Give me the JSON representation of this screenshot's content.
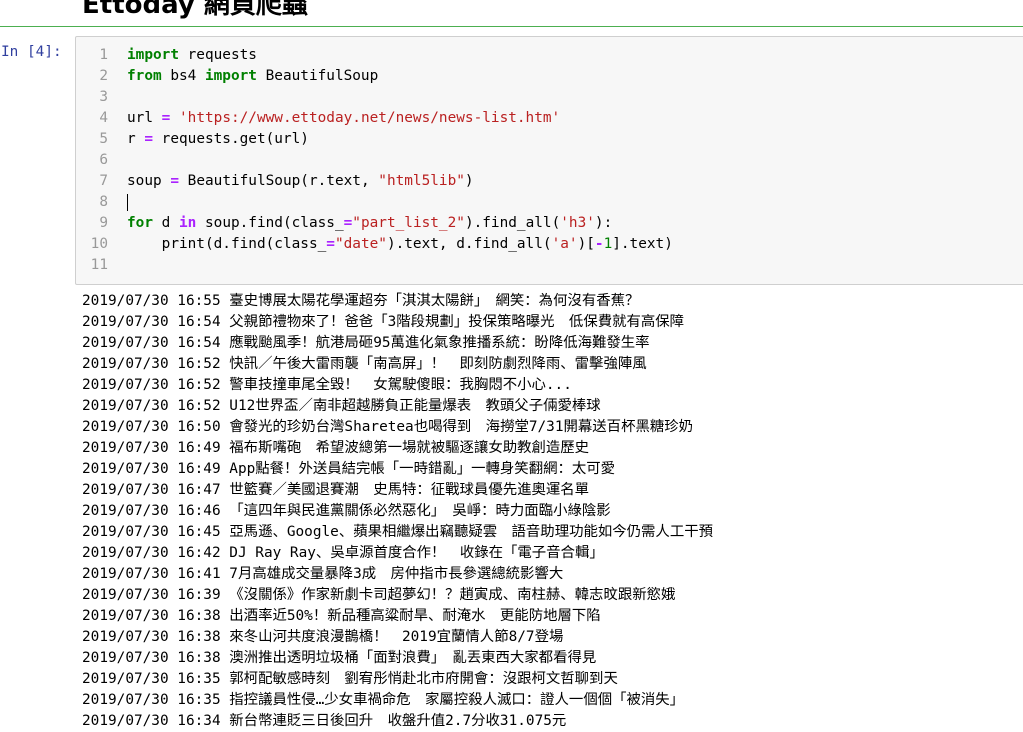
{
  "heading": "Ettoday 網頁爬蟲",
  "cell": {
    "prompt": "In [4]:",
    "code_lines": [
      [
        {
          "c": "kw",
          "t": "import"
        },
        {
          "c": "",
          "t": " requests"
        }
      ],
      [
        {
          "c": "kw",
          "t": "from"
        },
        {
          "c": "",
          "t": " bs4 "
        },
        {
          "c": "kw",
          "t": "import"
        },
        {
          "c": "",
          "t": " BeautifulSoup"
        }
      ],
      [],
      [
        {
          "c": "",
          "t": "url "
        },
        {
          "c": "op",
          "t": "="
        },
        {
          "c": "",
          "t": " "
        },
        {
          "c": "str",
          "t": "'https://www.ettoday.net/news/news-list.htm'"
        }
      ],
      [
        {
          "c": "",
          "t": "r "
        },
        {
          "c": "op",
          "t": "="
        },
        {
          "c": "",
          "t": " requests.get(url)"
        }
      ],
      [],
      [
        {
          "c": "",
          "t": "soup "
        },
        {
          "c": "op",
          "t": "="
        },
        {
          "c": "",
          "t": " BeautifulSoup(r.text, "
        },
        {
          "c": "str",
          "t": "\"html5lib\""
        },
        {
          "c": "",
          "t": ")"
        }
      ],
      [
        {
          "c": "cursor",
          "t": ""
        }
      ],
      [
        {
          "c": "kw",
          "t": "for"
        },
        {
          "c": "",
          "t": " d "
        },
        {
          "c": "op",
          "t": "in"
        },
        {
          "c": "",
          "t": " soup.find(class_"
        },
        {
          "c": "op",
          "t": "="
        },
        {
          "c": "str",
          "t": "\"part_list_2\""
        },
        {
          "c": "",
          "t": ").find_all("
        },
        {
          "c": "str",
          "t": "'h3'"
        },
        {
          "c": "",
          "t": "):"
        }
      ],
      [
        {
          "c": "",
          "t": "    print(d.find(class_"
        },
        {
          "c": "op",
          "t": "="
        },
        {
          "c": "str",
          "t": "\"date\""
        },
        {
          "c": "",
          "t": ").text, d.find_all("
        },
        {
          "c": "str",
          "t": "'a'"
        },
        {
          "c": "",
          "t": ")["
        },
        {
          "c": "op",
          "t": "-"
        },
        {
          "c": "num",
          "t": "1"
        },
        {
          "c": "",
          "t": "].text)"
        }
      ],
      []
    ]
  },
  "output_lines": [
    "2019/07/30 16:55 臺史博展太陽花學運超夯「淇淇太陽餅」　網笑：為何沒有香蕉？",
    "2019/07/30 16:54 父親節禮物來了！爸爸「3階段規劃」投保策略曝光　低保費就有高保障",
    "2019/07/30 16:54 應戰颱風季！航港局砸95萬進化氣象推播系統：盼降低海難發生率",
    "2019/07/30 16:52 快訊／午後大雷雨襲「南高屏」！　即刻防劇烈降雨、雷擊強陣風",
    "2019/07/30 16:52 警車技撞車尾全毀！　女駕駛傻眼：我胸悶不小心...",
    "2019/07/30 16:52 U12世界盃／南非超越勝負正能量爆表　教頭父子倆愛棒球",
    "2019/07/30 16:50 會發光的珍奶台灣Sharetea也喝得到　海撈堂7/31開幕送百杯黑糖珍奶",
    "2019/07/30 16:49 福布斯嘴砲　希望波總第一場就被驅逐讓女助教創造歷史",
    "2019/07/30 16:49 App點餐！外送員結完帳「一時錯亂」一轉身笑翻網：太可愛",
    "2019/07/30 16:47 世籃賽／美國退賽潮　史馬特：征戰球員優先進奧運名單",
    "2019/07/30 16:46 「這四年與民進黨關係必然惡化」　吳崢：時力面臨小綠陰影",
    "2019/07/30 16:45 亞馬遜、Google、蘋果相繼爆出竊聽疑雲　語音助理功能如今仍需人工干預",
    "2019/07/30 16:42 DJ Ray Ray、吳卓源首度合作！　收錄在「電子音合輯」",
    "2019/07/30 16:41 7月高雄成交量暴降3成　房仲指市長參選總統影響大",
    "2019/07/30 16:39 《沒關係》作家新劇卡司超夢幻！？趙寅成、南柱赫、韓志旼跟新慾娥",
    "2019/07/30 16:38 出酒率近50%！新品種高粱耐旱、耐淹水　更能防地層下陷",
    "2019/07/30 16:38 來冬山河共度浪漫鵲橋！　2019宜蘭情人節8/7登場",
    "2019/07/30 16:38 澳洲推出透明垃圾桶「面對浪費」　亂丟東西大家都看得見",
    "2019/07/30 16:35 郭柯配敏感時刻　劉宥彤悄赴北市府開會：沒跟柯文哲聊到天",
    "2019/07/30 16:35 指控議員性侵…少女車禍命危　家屬控殺人滅口：證人一個個「被消失」",
    "2019/07/30 16:34 新台幣連貶三日後回升　收盤升值2.7分收31.075元"
  ]
}
